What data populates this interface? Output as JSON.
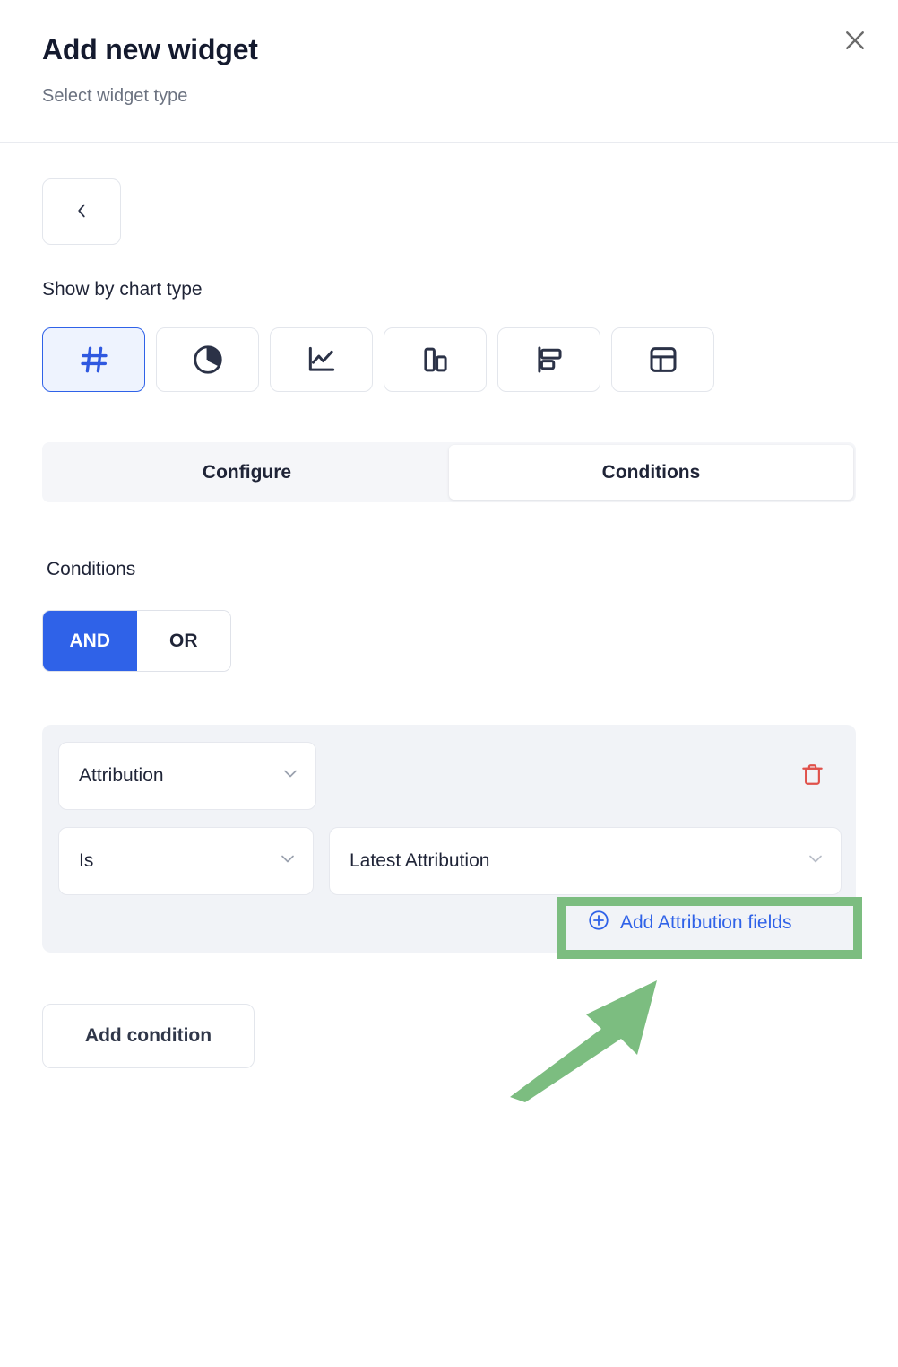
{
  "header": {
    "title": "Add new widget",
    "subtitle": "Select widget type",
    "close_icon": "close-icon"
  },
  "nav": {
    "back_icon": "chevron-left-icon"
  },
  "chart_type": {
    "label": "Show by chart type",
    "selected_index": 0,
    "options": [
      {
        "name": "number",
        "icon": "hash-icon"
      },
      {
        "name": "pie",
        "icon": "pie-chart-icon"
      },
      {
        "name": "line",
        "icon": "line-chart-icon"
      },
      {
        "name": "column",
        "icon": "column-chart-icon"
      },
      {
        "name": "bar",
        "icon": "bar-chart-icon"
      },
      {
        "name": "table",
        "icon": "table-icon"
      }
    ]
  },
  "tabs": [
    {
      "label": "Configure",
      "active": false
    },
    {
      "label": "Conditions",
      "active": true
    }
  ],
  "conditions": {
    "label": "Conditions",
    "logic": {
      "options": [
        "AND",
        "OR"
      ],
      "selected": "AND"
    },
    "rows": [
      {
        "field": "Attribution",
        "operator": "Is",
        "value": "Latest Attribution",
        "add_fields_label": "Add Attribution fields",
        "add_fields_icon": "plus-circle-icon",
        "delete_icon": "trash-icon"
      }
    ],
    "add_condition_label": "Add condition"
  },
  "colors": {
    "accent_blue": "#2f62e8",
    "selected_bg": "#eef3fe",
    "danger_red": "#e0514b",
    "card_bg": "#f1f3f7",
    "tab_bg": "#f5f6f9",
    "annotation_green": "#7cbd80"
  },
  "annotations": {
    "highlight_target": "Add Attribution fields",
    "arrow": "pointer-arrow-up-right"
  }
}
